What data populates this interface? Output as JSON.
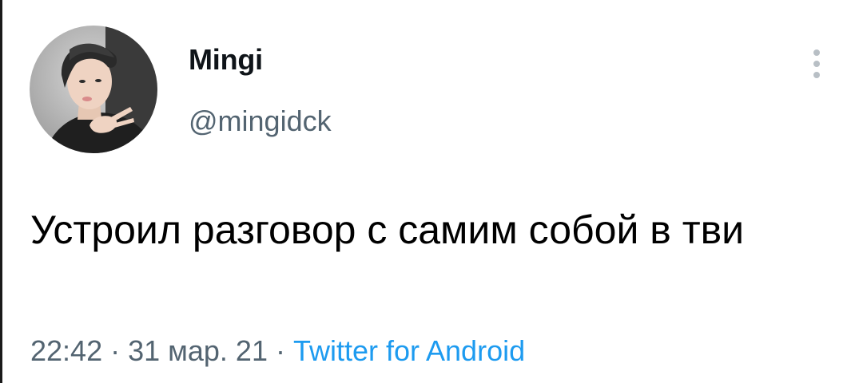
{
  "tweet": {
    "author": {
      "display_name": "Mingi",
      "handle": "@mingidck",
      "avatar_icon": "avatar-photo"
    },
    "text": "Устроил разговор с самим собой в тви",
    "time": "22:42",
    "date": "31 мар. 21",
    "separator": "·",
    "source": "Twitter for Android",
    "more_icon": "more-vertical-icon"
  },
  "colors": {
    "name": "#0f1419",
    "secondary": "#536471",
    "link": "#1d9bf0",
    "more_dots": "#b8bfc5"
  }
}
